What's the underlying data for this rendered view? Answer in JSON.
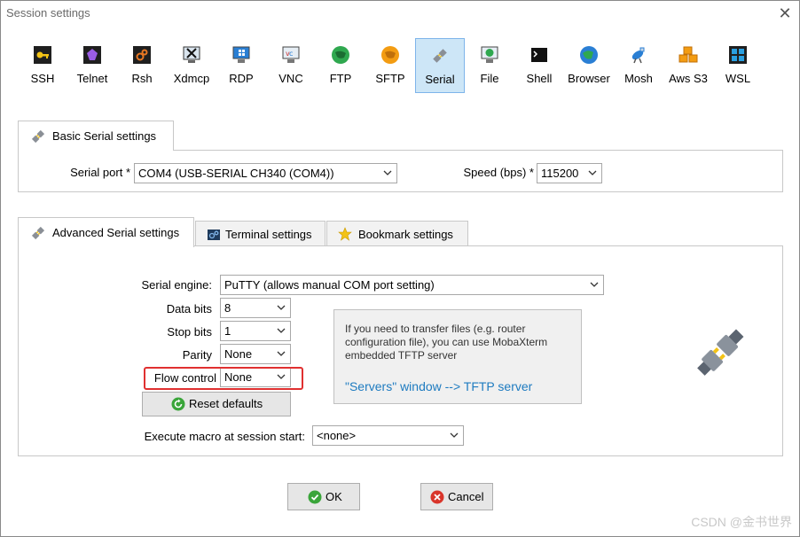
{
  "window": {
    "title": "Session settings",
    "close_glyph": "✕"
  },
  "toolbar": {
    "items": [
      {
        "label": "SSH",
        "icon": "key-icon"
      },
      {
        "label": "Telnet",
        "icon": "telnet-icon"
      },
      {
        "label": "Rsh",
        "icon": "rsh-icon"
      },
      {
        "label": "Xdmcp",
        "icon": "xdmcp-icon"
      },
      {
        "label": "RDP",
        "icon": "rdp-monitor-icon"
      },
      {
        "label": "VNC",
        "icon": "vnc-icon"
      },
      {
        "label": "FTP",
        "icon": "ftp-globe-icon"
      },
      {
        "label": "SFTP",
        "icon": "sftp-globe-icon"
      },
      {
        "label": "Serial",
        "icon": "serial-plug-icon",
        "active": true
      },
      {
        "label": "File",
        "icon": "file-monitor-icon"
      },
      {
        "label": "Shell",
        "icon": "shell-terminal-icon"
      },
      {
        "label": "Browser",
        "icon": "browser-globe-icon"
      },
      {
        "label": "Mosh",
        "icon": "mosh-satellite-icon"
      },
      {
        "label": "Aws S3",
        "icon": "aws-cubes-icon"
      },
      {
        "label": "WSL",
        "icon": "windows-icon"
      }
    ]
  },
  "basic": {
    "tab_label": "Basic Serial settings",
    "serial_port_label": "Serial port *",
    "serial_port_value": "COM4  (USB-SERIAL CH340 (COM4))",
    "speed_label": "Speed (bps) *",
    "speed_value": "115200"
  },
  "advanced_tabs": [
    {
      "label": "Advanced Serial settings",
      "selected": true
    },
    {
      "label": "Terminal settings"
    },
    {
      "label": "Bookmark settings"
    }
  ],
  "advanced": {
    "serial_engine_label": "Serial engine:",
    "serial_engine_value": "PuTTY    (allows manual COM port setting)",
    "data_bits_label": "Data bits",
    "data_bits_value": "8",
    "stop_bits_label": "Stop bits",
    "stop_bits_value": "1",
    "parity_label": "Parity",
    "parity_value": "None",
    "flow_control_label": "Flow control",
    "flow_control_value": "None",
    "reset_label": "Reset defaults",
    "macro_label": "Execute macro at session start:",
    "macro_value": "<none>",
    "info_text": "If you need to transfer files (e.g. router configuration file), you can use MobaXterm embedded TFTP server",
    "info_link": "\"Servers\" window  -->  TFTP server"
  },
  "footer": {
    "ok_label": "OK",
    "cancel_label": "Cancel"
  },
  "watermark": "CSDN @金书世界",
  "colors": {
    "accent_blue": "#1e7bc0",
    "highlight_red": "#e03030",
    "active_tool_bg": "#cde6f7"
  }
}
